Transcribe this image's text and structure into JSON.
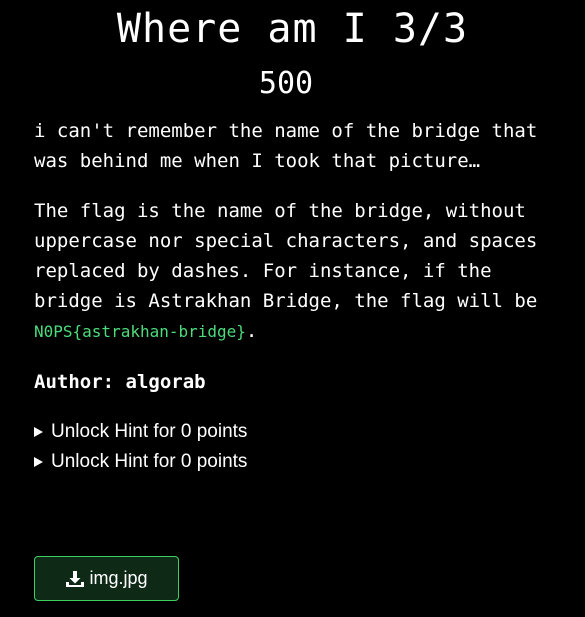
{
  "challenge": {
    "title": "Where am I 3/3",
    "points": "500"
  },
  "description": {
    "paragraph1": "i can't remember the name of the bridge that was behind me when I took that picture…",
    "paragraph2_text": "The flag is the name of the bridge, without uppercase nor special characters, and spaces replaced by dashes. For instance, if the bridge is Astrakhan Bridge, the flag will be ",
    "paragraph2_flag": "N0PS{astrakhan-bridge}",
    "paragraph2_end": "."
  },
  "author": {
    "label": "Author: algorab"
  },
  "hints": [
    {
      "label": "Unlock Hint for 0 points"
    },
    {
      "label": "Unlock Hint for 0 points"
    }
  ],
  "download": {
    "label": "img.jpg",
    "icon": "download-icon"
  },
  "colors": {
    "background": "#000000",
    "text": "#ffffff",
    "code": "#4cdc7c",
    "button_border": "#3fcf5f",
    "button_bg": "#0e2a17"
  }
}
